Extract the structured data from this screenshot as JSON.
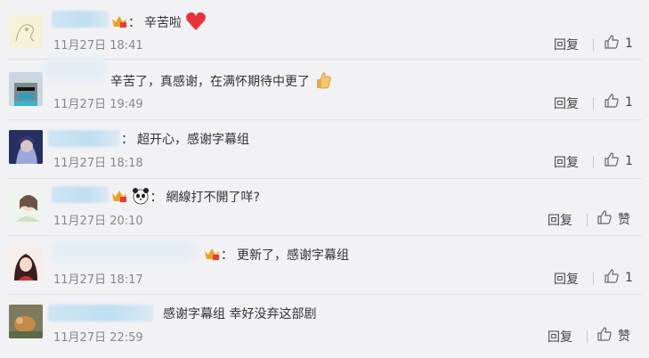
{
  "comments": [
    {
      "text": "辛苦啦",
      "time": "11月27日 18:41",
      "reply": "回复",
      "likes": "1"
    },
    {
      "text": "辛苦了，真感谢，在满怀期待中更了",
      "time": "11月27日 19:49",
      "reply": "回复",
      "likes": "1"
    },
    {
      "text": "超开心，感谢字幕组",
      "time": "11月27日 18:18",
      "reply": "回复",
      "likes": "1"
    },
    {
      "text": "網線打不開了咩?",
      "time": "11月27日 20:10",
      "reply": "回复",
      "likes": "赞"
    },
    {
      "text": "更新了，感谢字幕组",
      "time": "11月27日 18:17",
      "reply": "回复",
      "likes": "1"
    },
    {
      "text": "感谢字幕组 幸好没弃这部剧",
      "time": "11月27日 22:59",
      "reply": "回复",
      "likes": "赞"
    }
  ],
  "colon": "：",
  "colors": {
    "background": "#f2f2f5",
    "text": "#333333",
    "time": "#888888",
    "heart": "#e8333a"
  }
}
